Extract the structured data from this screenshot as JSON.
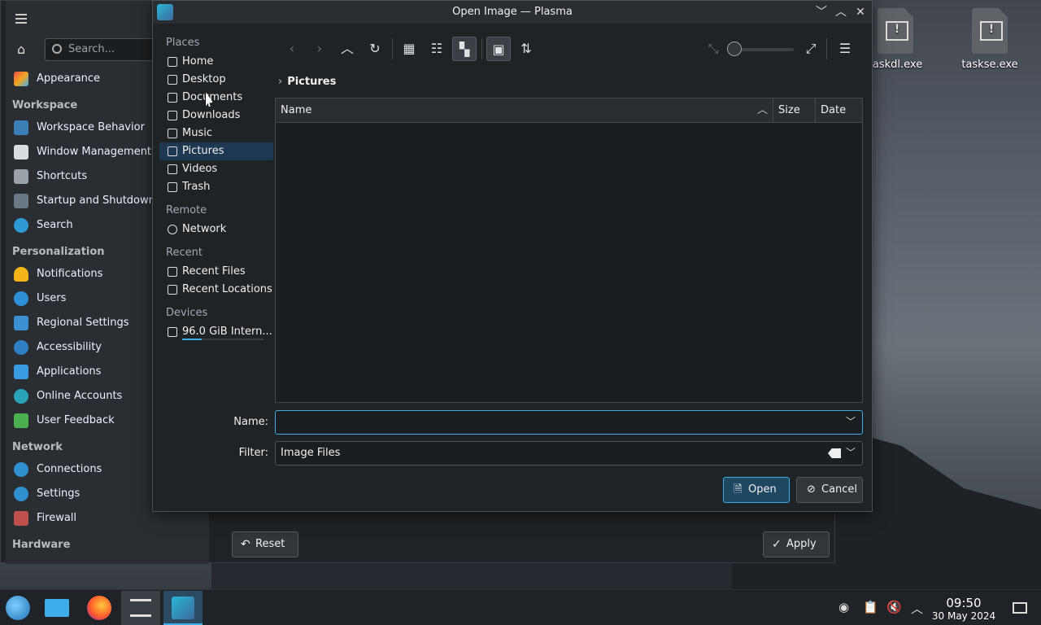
{
  "desktop": {
    "icons": [
      {
        "label": "taskdl.exe"
      },
      {
        "label": "taskse.exe"
      }
    ]
  },
  "settings_window": {
    "search_placeholder": "Search...",
    "nav": {
      "top_item": "Appearance",
      "workspace_header": "Workspace",
      "workspace_items": [
        "Workspace Behavior",
        "Window Management",
        "Shortcuts",
        "Startup and Shutdown",
        "Search"
      ],
      "personalization_header": "Personalization",
      "personalization_items": [
        "Notifications",
        "Users",
        "Regional Settings",
        "Accessibility",
        "Applications",
        "Online Accounts",
        "User Feedback"
      ],
      "network_header": "Network",
      "network_items": [
        "Connections",
        "Settings",
        "Firewall"
      ],
      "hardware_header": "Hardware"
    },
    "reset_label": "Reset",
    "apply_label": "Apply"
  },
  "dialog": {
    "title": "Open Image — Plasma",
    "places_header": "Places",
    "places": [
      "Home",
      "Desktop",
      "Documents",
      "Downloads",
      "Music",
      "Pictures",
      "Videos",
      "Trash"
    ],
    "selected_place": "Pictures",
    "remote_header": "Remote",
    "remote": [
      "Network"
    ],
    "recent_header": "Recent",
    "recent": [
      "Recent Files",
      "Recent Locations"
    ],
    "devices_header": "Devices",
    "devices": [
      "96.0 GiB Intern..."
    ],
    "breadcrumb": "Pictures",
    "columns": [
      "Name",
      "Size",
      "Date"
    ],
    "name_label": "Name:",
    "name_value": "",
    "filter_label": "Filter:",
    "filter_value": "Image Files",
    "open_label": "Open",
    "cancel_label": "Cancel"
  },
  "taskbar": {
    "time": "09:50",
    "date": "30 May 2024"
  },
  "colors": {
    "accent": "#3daee9",
    "selection": "#1d3850",
    "window_bg": "#202326",
    "sidebar_bg": "#2a2e32"
  }
}
